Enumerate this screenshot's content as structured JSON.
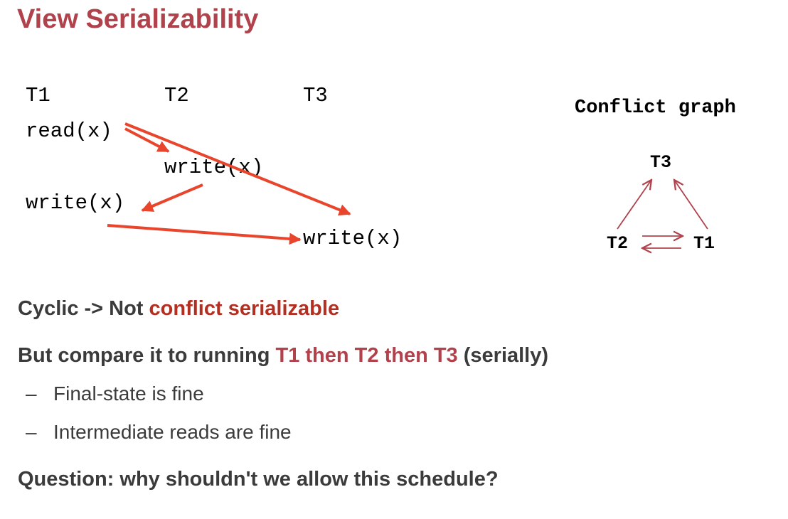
{
  "slide": {
    "title": "View Serializability"
  },
  "schedule": {
    "headers": [
      "T1",
      "T2",
      "T3"
    ],
    "ops": {
      "t1_read": "read(x)",
      "t2_write": "write(x)",
      "t1_write": "write(x)",
      "t3_write": "write(x)"
    },
    "arrow_color": "#e8452c"
  },
  "conflict_graph": {
    "title": "Conflict graph",
    "nodes": [
      "T3",
      "T2",
      "T1"
    ],
    "edges": [
      {
        "from": "T2",
        "to": "T3"
      },
      {
        "from": "T1",
        "to": "T3"
      },
      {
        "from": "T2",
        "to": "T1"
      },
      {
        "from": "T1",
        "to": "T2"
      }
    ],
    "edge_color": "#b1424c"
  },
  "text": {
    "line1_a": "Cyclic -> Not ",
    "line1_b": "conflict serializable",
    "line2_a": "But compare it to running ",
    "line2_b": "T1 then T2 then T3",
    "line2_c": " (serially)",
    "bullets": [
      "Final-state is fine",
      "Intermediate reads are fine"
    ],
    "bullet_marker": "–",
    "question": "Question: why shouldn't we allow this schedule?"
  }
}
